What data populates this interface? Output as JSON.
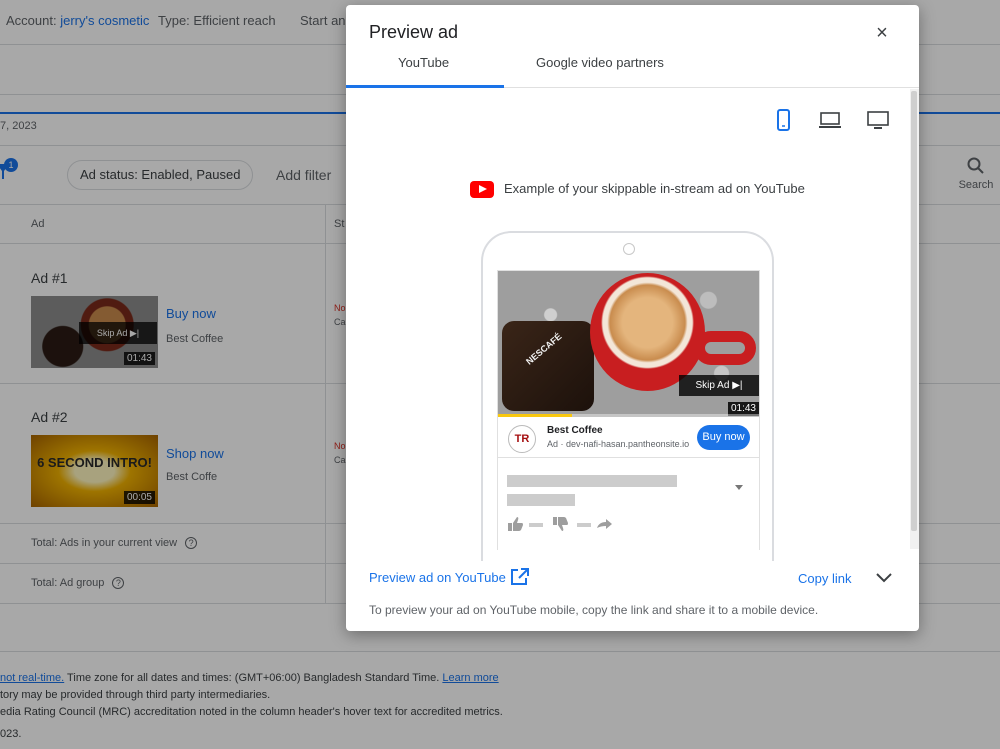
{
  "topbar": {
    "account_label": "Account:",
    "account_value": "jerry's cosmetic",
    "type_label": "Type:",
    "type_value": "Efficient reach",
    "start_trunc": "Start an"
  },
  "date_trunc": "7, 2023",
  "filters": {
    "count": "1",
    "chip": "Ad status: Enabled, Paused",
    "add_filter": "Add filter",
    "search": "Search"
  },
  "table": {
    "col_ad": "Ad",
    "col_status_trunc": "St",
    "ads": [
      {
        "title": "Ad #1",
        "skip": "Skip Ad ▶|",
        "duration": "01:43",
        "cta": "Buy now",
        "headline": "Best Coffee",
        "status_red": "No",
        "status_sub": "Ca"
      },
      {
        "title": "Ad #2",
        "thumb_text": "6 SECOND INTRO!",
        "duration": "00:05",
        "cta": "Shop now",
        "headline": "Best Coffe",
        "status_red": "No",
        "status_sub": "Ca"
      }
    ],
    "total_view": "Total: Ads in your current view",
    "total_group": "Total: Ad group",
    "help": "?"
  },
  "footer": {
    "line1_link": "not real-time.",
    "line1_text": " Time zone for all dates and times: (GMT+06:00) Bangladesh Standard Time. ",
    "line1_learn": "Learn more",
    "line2": "tory may be provided through third party intermediaries.",
    "line3": "edia Rating Council (MRC) accreditation noted in the column header's hover text for accredited metrics.",
    "line4": "023."
  },
  "modal": {
    "title": "Preview ad",
    "close": "×",
    "tabs": [
      "YouTube",
      "Google video partners"
    ],
    "active_tab": "YouTube",
    "devices": [
      "mobile-icon",
      "laptop-icon",
      "tv-icon"
    ],
    "example_text": "Example of your skippable in-stream ad on YouTube",
    "preview": {
      "skip": "Skip Ad ▶|",
      "duration": "01:43",
      "progress": 0.28,
      "jar_label": "NESCAFÉ",
      "avatar": "TR",
      "advertiser": "Best Coffee",
      "url": "Ad · dev-nafi-hasan.pantheonsite.io",
      "cta": "Buy now"
    },
    "preview_on_youtube": "Preview ad on YouTube",
    "copy_link": "Copy link",
    "note": "To preview your ad on YouTube mobile, copy the link and share it to a mobile device."
  },
  "colors": {
    "accent": "#1a73e8",
    "youtube_red": "#ff0000",
    "mug_red": "#c81e20"
  }
}
